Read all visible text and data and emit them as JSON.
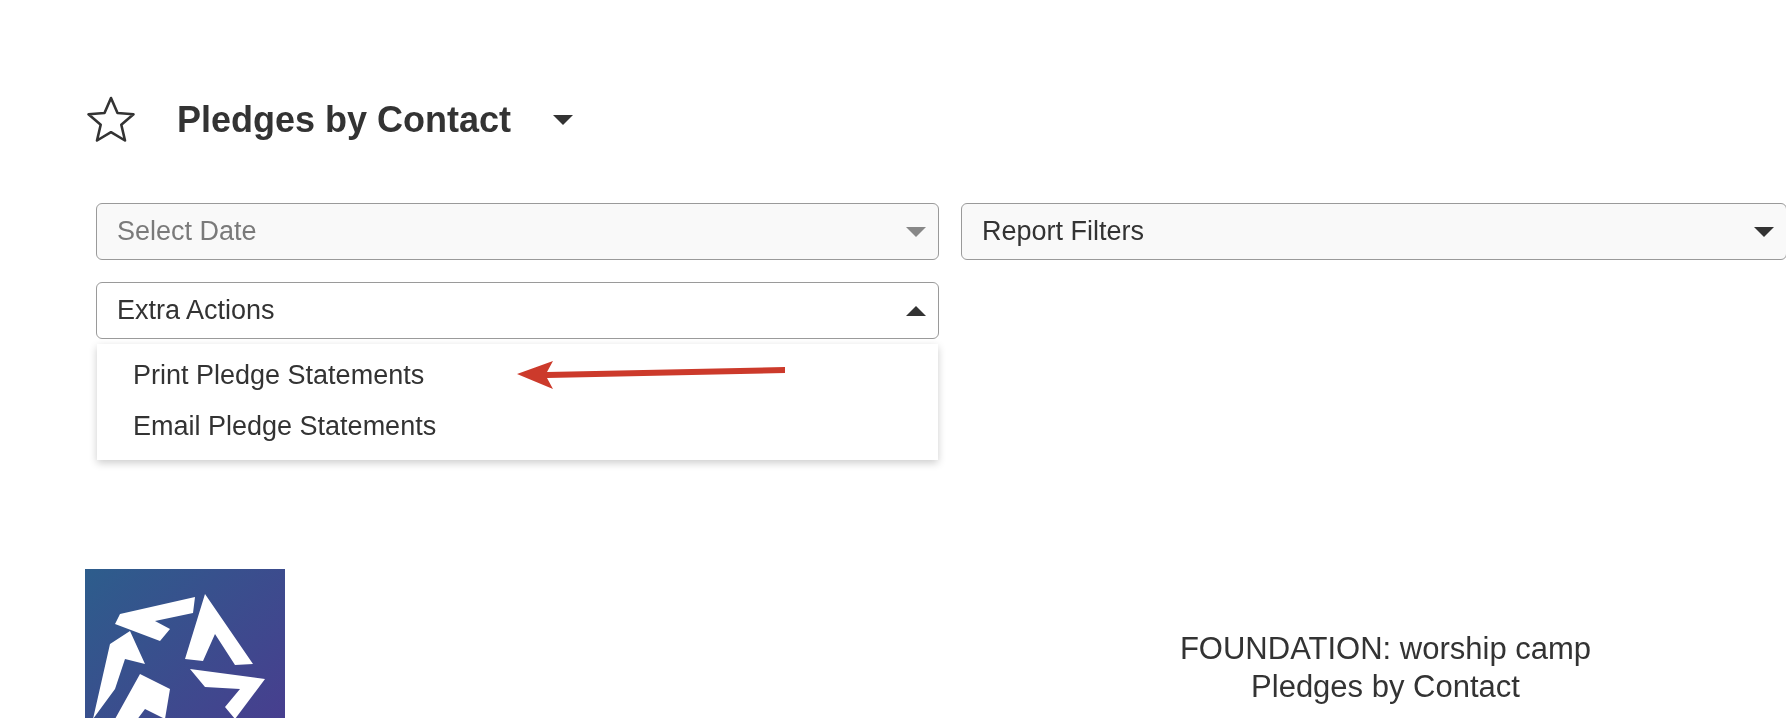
{
  "header": {
    "title": "Pledges by Contact",
    "favorite": false
  },
  "filters": [
    {
      "placeholder": "Select Date",
      "expanded": false
    },
    {
      "value": "Report Filters",
      "expanded": false
    }
  ],
  "actions": {
    "label": "Extra Actions",
    "expanded": true,
    "items": [
      "Print Pledge Statements",
      "Email Pledge Statements"
    ]
  },
  "report": {
    "lines": [
      "FOUNDATION: worship camp",
      "Pledges by Contact"
    ]
  }
}
